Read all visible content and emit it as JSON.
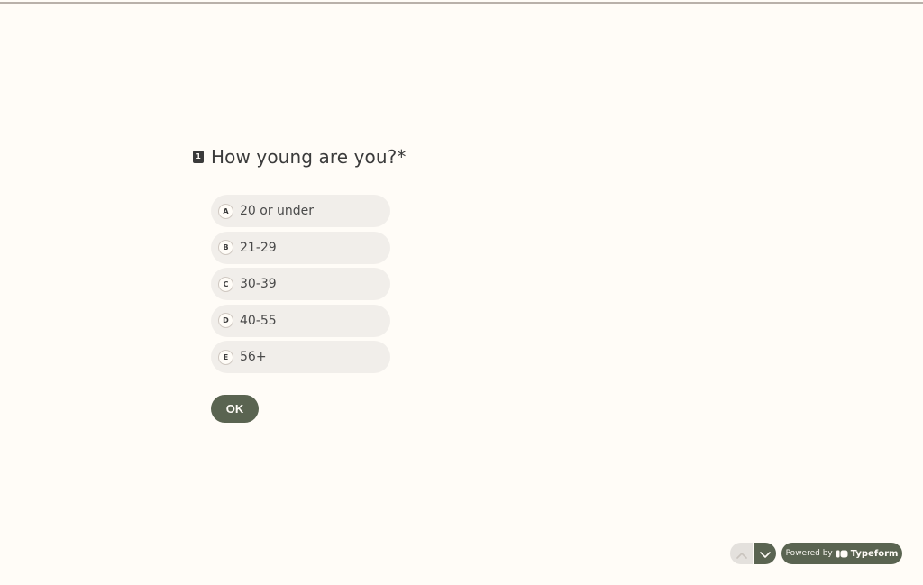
{
  "question": {
    "number": "1",
    "title": "How young are you?",
    "required_mark": "*"
  },
  "choices": [
    {
      "key": "A",
      "label": "20 or under"
    },
    {
      "key": "B",
      "label": "21-29"
    },
    {
      "key": "C",
      "label": "30-39"
    },
    {
      "key": "D",
      "label": "40-55"
    },
    {
      "key": "E",
      "label": "56+"
    }
  ],
  "ok_button": {
    "label": "OK"
  },
  "footer": {
    "powered_by": "Powered by",
    "brand": "Typeform"
  },
  "colors": {
    "background": "#fffcf7",
    "accent": "#5a6451",
    "choice_bg": "#f1eeea",
    "text": "#3b3b3b"
  },
  "icons": {
    "nav_up": "chevron-up-icon",
    "nav_down": "chevron-down-icon",
    "brand": "typeform-logo-icon"
  }
}
